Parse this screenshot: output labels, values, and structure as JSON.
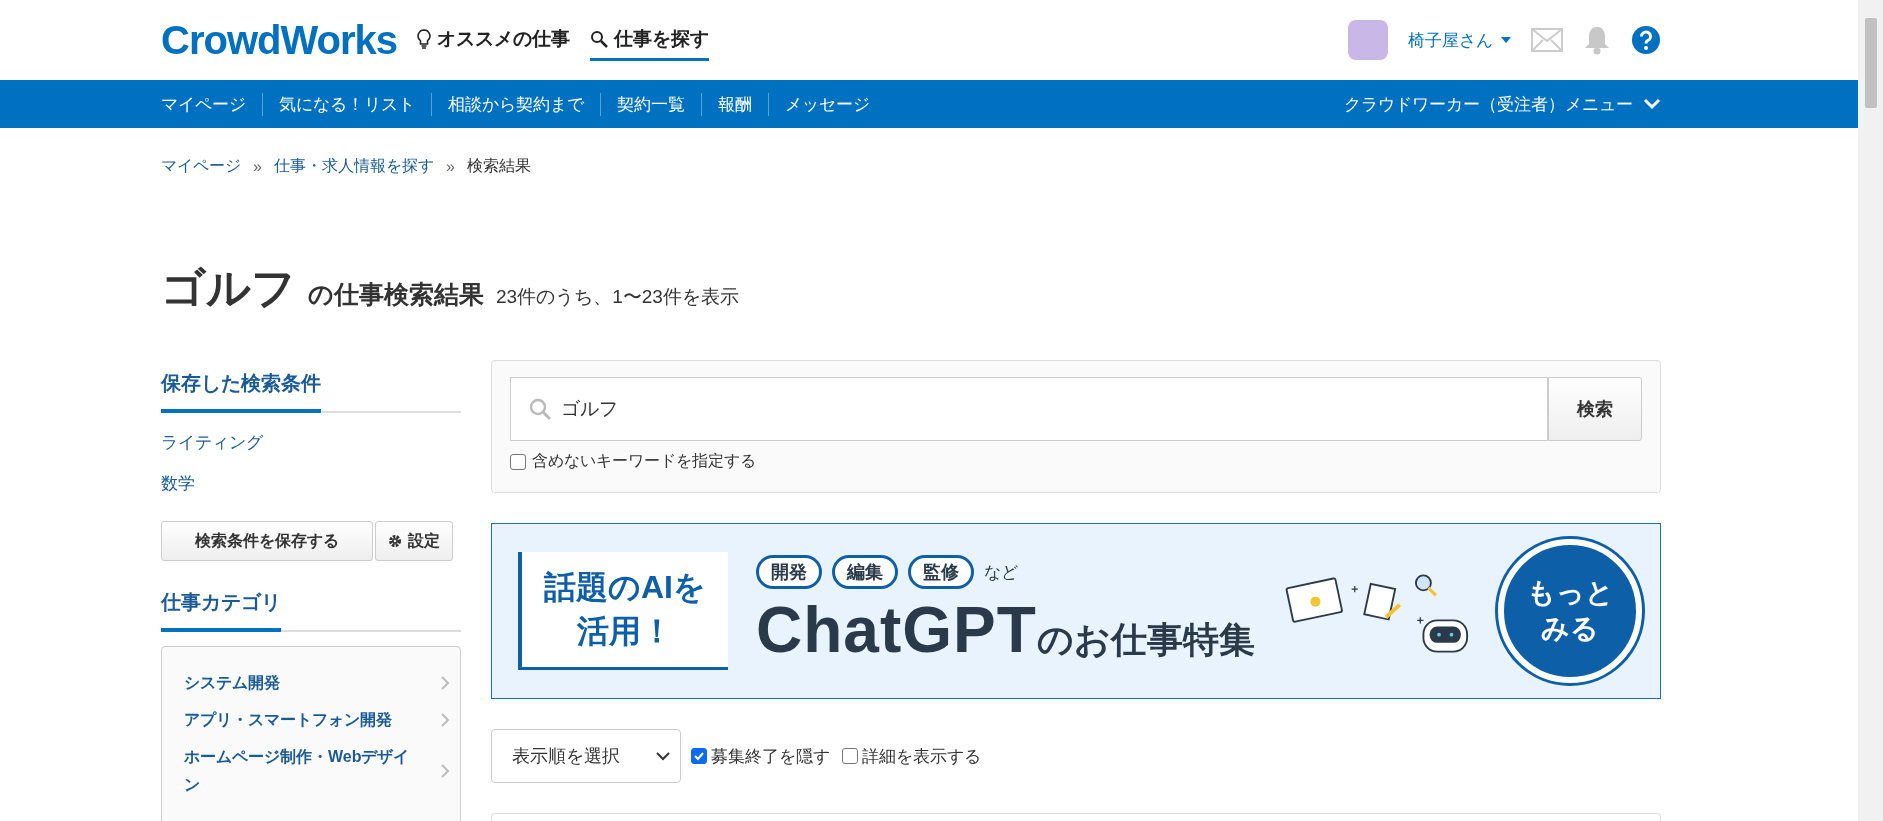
{
  "header": {
    "logo": "CrowdWorks",
    "links": [
      {
        "label": "オススメの仕事",
        "selected": false
      },
      {
        "label": "仕事を探す",
        "selected": true
      }
    ],
    "user": {
      "name": "椅子屋さん"
    }
  },
  "nav": {
    "items": [
      "マイページ",
      "気になる！リスト",
      "相談から契約まで",
      "契約一覧",
      "報酬",
      "メッセージ"
    ],
    "menu": "クラウドワーカー（受注者）メニュー"
  },
  "breadcrumb": [
    {
      "label": "マイページ",
      "link": true
    },
    {
      "label": "仕事・求人情報を探す",
      "link": true
    },
    {
      "label": "検索結果",
      "link": false
    }
  ],
  "breadcrumb_separator": "»",
  "title": {
    "keyword": "ゴルフ",
    "suffix": "の仕事検索結果",
    "count": "23件のうち、1〜23件を表示"
  },
  "sidebar": {
    "saved_heading": "保存した検索条件",
    "saved": [
      "ライティング",
      "数学"
    ],
    "save_button": "検索条件を保存する",
    "settings_button": "設定",
    "category_heading": "仕事カテゴリ",
    "categories": [
      "システム開発",
      "アプリ・スマートフォン開発",
      "ホームページ制作・Webデザイン"
    ]
  },
  "search": {
    "value": "ゴルフ",
    "button": "検索",
    "exclude": {
      "label": "含めないキーワードを指定する",
      "checked": false
    }
  },
  "banner": {
    "callout": [
      "話題のAIを",
      "活用！"
    ],
    "tags": [
      "開発",
      "編集",
      "監修"
    ],
    "tags_suffix": "など",
    "headline": "ChatGPT",
    "headline_suffix": "のお仕事特集",
    "more": [
      "もっと",
      "みる"
    ]
  },
  "controls": {
    "sort": "表示順を選択",
    "options": [
      {
        "label": "募集終了を隠す",
        "checked": true
      },
      {
        "label": "詳細を表示する",
        "checked": false
      }
    ]
  }
}
